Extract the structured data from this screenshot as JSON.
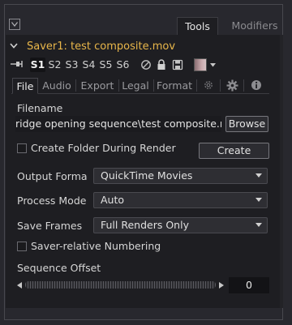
{
  "header": {
    "tabs": [
      {
        "label": "Tools",
        "active": true
      },
      {
        "label": "Modifiers",
        "active": false
      }
    ]
  },
  "tool": {
    "title": "Saver1: test composite.mov",
    "title_color": "#e8b64a"
  },
  "toolbar": {
    "slots": [
      "S1",
      "S2",
      "S3",
      "S4",
      "S5",
      "S6"
    ],
    "active_slot": "S1",
    "icons": [
      "pin-icon",
      "disable-icon",
      "lock-icon",
      "cache-icon",
      "color-swatch",
      "chevron-down-icon"
    ]
  },
  "panel_tabs": [
    {
      "label": "File",
      "active": true
    },
    {
      "label": "Audio"
    },
    {
      "label": "Export"
    },
    {
      "label": "Legal"
    },
    {
      "label": "Format"
    }
  ],
  "panel_tab_icons": [
    "settings-icon",
    "gear-icon",
    "info-icon"
  ],
  "file": {
    "filename_label": "Filename",
    "filename_value": "ridge opening sequence\\test composite.mov",
    "browse_label": "Browse",
    "create_folder_label": "Create Folder During Render",
    "create_folder_checked": false,
    "create_label": "Create",
    "output_format_label": "Output Forma",
    "output_format_value": "QuickTime Movies",
    "process_mode_label": "Process Mode",
    "process_mode_value": "Auto",
    "save_frames_label": "Save Frames",
    "save_frames_value": "Full Renders Only",
    "saver_relative_label": "Saver-relative Numbering",
    "saver_relative_checked": false,
    "sequence_offset_label": "Sequence Offset",
    "sequence_offset_value": "0"
  }
}
